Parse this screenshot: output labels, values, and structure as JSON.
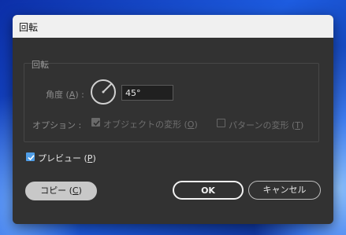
{
  "dialog": {
    "title": "回転",
    "group_label": "回転",
    "angle": {
      "label_prefix": "角度 (",
      "label_key": "A",
      "label_suffix": ") :",
      "value": "45°"
    },
    "options": {
      "label": "オプション :",
      "transform_objects": {
        "label_prefix": "オブジェクトの変形 (",
        "label_key": "O",
        "label_suffix": ")",
        "checked": true,
        "enabled": false
      },
      "transform_patterns": {
        "label_prefix": "パターンの変形 (",
        "label_key": "T",
        "label_suffix": ")",
        "checked": false,
        "enabled": false
      }
    },
    "preview": {
      "label_prefix": "プレビュー (",
      "label_key": "P",
      "label_suffix": ")",
      "checked": true
    },
    "buttons": {
      "copy": {
        "label_prefix": "コピー (",
        "label_key": "C",
        "label_suffix": ")"
      },
      "ok": "OK",
      "cancel": "キャンセル"
    }
  },
  "colors": {
    "dialog_bg": "#323232",
    "titlebar_bg": "#f0f0f0",
    "accent": "#4f9de6"
  }
}
